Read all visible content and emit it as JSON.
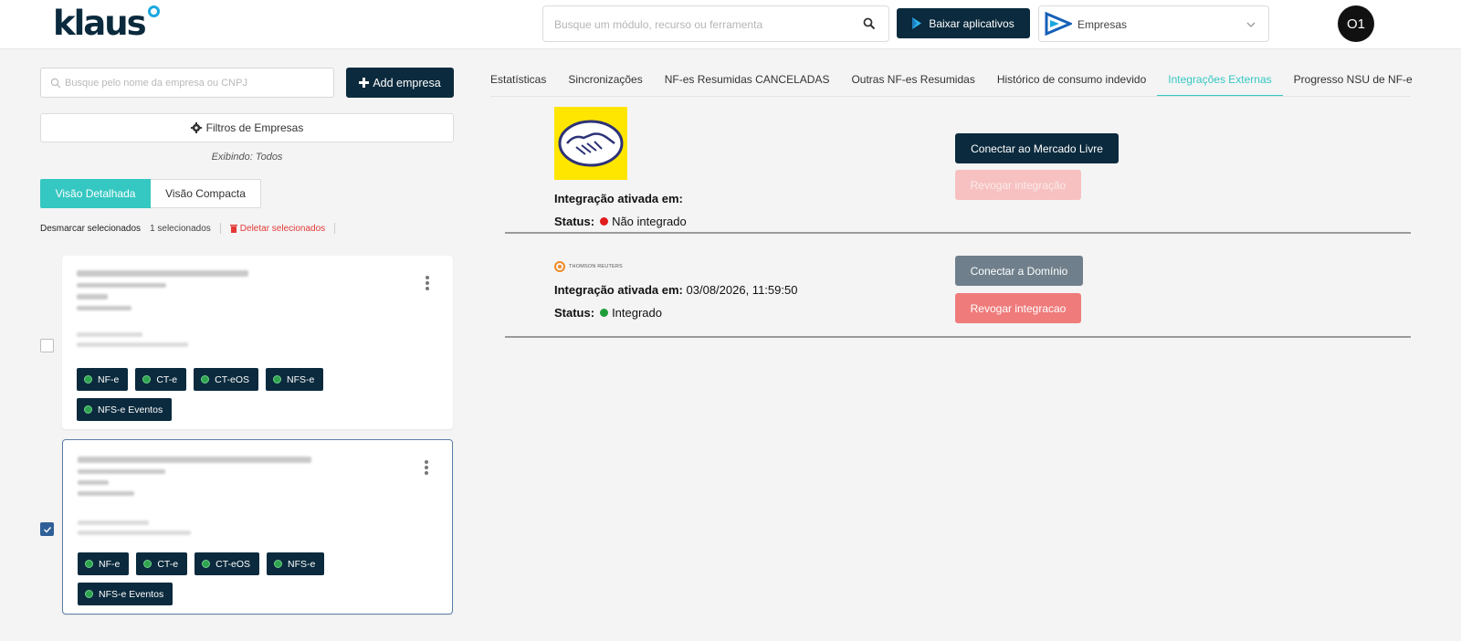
{
  "header": {
    "logo_text": "klaus",
    "search_placeholder": "Busque um módulo, recurso ou ferramenta",
    "download_button": "Baixar aplicativos",
    "module_selector": "Empresas",
    "avatar_initials": "O1"
  },
  "sidebar": {
    "search_placeholder": "Busque pelo nome da empresa ou CNPJ",
    "add_button": "Add empresa",
    "filters_button": "Filtros de Empresas",
    "showing_text": "Exibindo: Todos",
    "view_detailed": "Visão Detalhada",
    "view_compact": "Visão Compacta",
    "deselect_label": "Desmarcar selecionados",
    "selected_count": "1 selecionados",
    "delete_label": "Deletar selecionados",
    "cards": [
      {
        "checked": false,
        "tags": [
          "NF-e",
          "CT-e",
          "CT-eOS",
          "NFS-e",
          "NFS-e Eventos"
        ]
      },
      {
        "checked": true,
        "tags": [
          "NF-e",
          "CT-e",
          "CT-eOS",
          "NFS-e",
          "NFS-e Eventos"
        ]
      }
    ]
  },
  "tabs": [
    {
      "label": "Estatísticas",
      "active": false
    },
    {
      "label": "Sincronizações",
      "active": false
    },
    {
      "label": "NF-es Resumidas CANCELADAS",
      "active": false
    },
    {
      "label": "Outras NF-es Resumidas",
      "active": false
    },
    {
      "label": "Histórico de consumo indevido",
      "active": false
    },
    {
      "label": "Integrações Externas",
      "active": true
    },
    {
      "label": "Progresso NSU de NF-e",
      "active": false
    }
  ],
  "integrations": {
    "mercado_livre": {
      "activated_label": "Integração ativada em:",
      "activated_value": "",
      "status_label": "Status:",
      "status_value": "Não integrado",
      "status_color": "#e21b1b",
      "connect_button": "Conectar ao Mercado Livre",
      "revoke_button": "Revogar integração"
    },
    "dominio": {
      "brand_text": "THOMSON REUTERS",
      "activated_label": "Integração ativada em:",
      "activated_value": "03/08/2026, 11:59:50",
      "status_label": "Status:",
      "status_value": "Integrado",
      "status_color": "#1f9d3a",
      "connect_button": "Conectar a Domínio",
      "revoke_button": "Revogar integracao"
    }
  },
  "colors": {
    "primary_dark": "#0b2a3d",
    "accent_teal": "#35c7c1",
    "danger": "#e53935"
  }
}
